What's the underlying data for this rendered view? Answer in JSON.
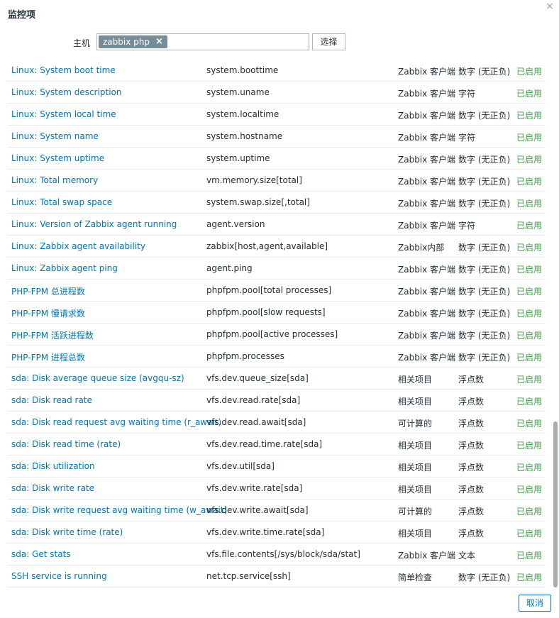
{
  "dialog": {
    "title": "监控项",
    "close_symbol": "×",
    "cancel_label": "取消"
  },
  "host_filter": {
    "label": "主机",
    "selected_host": "zabbix php",
    "remove_symbol": "×",
    "select_label": "选择"
  },
  "items": [
    {
      "name": "Linux: System boot time",
      "key": "system.boottime",
      "type": "Zabbix 客户端",
      "value_type": "数字 (无正负)",
      "status": "已启用"
    },
    {
      "name": "Linux: System description",
      "key": "system.uname",
      "type": "Zabbix 客户端",
      "value_type": "字符",
      "status": "已启用"
    },
    {
      "name": "Linux: System local time",
      "key": "system.localtime",
      "type": "Zabbix 客户端",
      "value_type": "数字 (无正负)",
      "status": "已启用"
    },
    {
      "name": "Linux: System name",
      "key": "system.hostname",
      "type": "Zabbix 客户端",
      "value_type": "字符",
      "status": "已启用"
    },
    {
      "name": "Linux: System uptime",
      "key": "system.uptime",
      "type": "Zabbix 客户端",
      "value_type": "数字 (无正负)",
      "status": "已启用"
    },
    {
      "name": "Linux: Total memory",
      "key": "vm.memory.size[total]",
      "type": "Zabbix 客户端",
      "value_type": "数字 (无正负)",
      "status": "已启用"
    },
    {
      "name": "Linux: Total swap space",
      "key": "system.swap.size[,total]",
      "type": "Zabbix 客户端",
      "value_type": "数字 (无正负)",
      "status": "已启用"
    },
    {
      "name": "Linux: Version of Zabbix agent running",
      "key": "agent.version",
      "type": "Zabbix 客户端",
      "value_type": "字符",
      "status": "已启用"
    },
    {
      "name": "Linux: Zabbix agent availability",
      "key": "zabbix[host,agent,available]",
      "type": "Zabbix内部",
      "value_type": "数字 (无正负)",
      "status": "已启用"
    },
    {
      "name": "Linux: Zabbix agent ping",
      "key": "agent.ping",
      "type": "Zabbix 客户端",
      "value_type": "数字 (无正负)",
      "status": "已启用"
    },
    {
      "name": "PHP-FPM 总进程数",
      "key": "phpfpm.pool[total processes]",
      "type": "Zabbix 客户端",
      "value_type": "数字 (无正负)",
      "status": "已启用"
    },
    {
      "name": "PHP-FPM 慢请求数",
      "key": "phpfpm.pool[slow requests]",
      "type": "Zabbix 客户端",
      "value_type": "数字 (无正负)",
      "status": "已启用"
    },
    {
      "name": "PHP-FPM 活跃进程数",
      "key": "phpfpm.pool[active processes]",
      "type": "Zabbix 客户端",
      "value_type": "数字 (无正负)",
      "status": "已启用"
    },
    {
      "name": "PHP-FPM 进程总数",
      "key": "phpfpm.processes",
      "type": "Zabbix 客户端",
      "value_type": "数字 (无正负)",
      "status": "已启用"
    },
    {
      "name": "sda: Disk average queue size (avgqu-sz)",
      "key": "vfs.dev.queue_size[sda]",
      "type": "相关项目",
      "value_type": "浮点数",
      "status": "已启用"
    },
    {
      "name": "sda: Disk read rate",
      "key": "vfs.dev.read.rate[sda]",
      "type": "相关项目",
      "value_type": "浮点数",
      "status": "已启用"
    },
    {
      "name": "sda: Disk read request avg waiting time (r_await)",
      "key": "vfs.dev.read.await[sda]",
      "type": "可计算的",
      "value_type": "浮点数",
      "status": "已启用"
    },
    {
      "name": "sda: Disk read time (rate)",
      "key": "vfs.dev.read.time.rate[sda]",
      "type": "相关项目",
      "value_type": "浮点数",
      "status": "已启用"
    },
    {
      "name": "sda: Disk utilization",
      "key": "vfs.dev.util[sda]",
      "type": "相关项目",
      "value_type": "浮点数",
      "status": "已启用"
    },
    {
      "name": "sda: Disk write rate",
      "key": "vfs.dev.write.rate[sda]",
      "type": "相关项目",
      "value_type": "浮点数",
      "status": "已启用"
    },
    {
      "name": "sda: Disk write request avg waiting time (w_await)",
      "key": "vfs.dev.write.await[sda]",
      "type": "可计算的",
      "value_type": "浮点数",
      "status": "已启用"
    },
    {
      "name": "sda: Disk write time (rate)",
      "key": "vfs.dev.write.time.rate[sda]",
      "type": "相关项目",
      "value_type": "浮点数",
      "status": "已启用"
    },
    {
      "name": "sda: Get stats",
      "key": "vfs.file.contents[/sys/block/sda/stat]",
      "type": "Zabbix 客户端",
      "value_type": "文本",
      "status": "已启用"
    },
    {
      "name": "SSH service is running",
      "key": "net.tcp.service[ssh]",
      "type": "简单检查",
      "value_type": "数字 (无正负)",
      "status": "已启用"
    }
  ]
}
